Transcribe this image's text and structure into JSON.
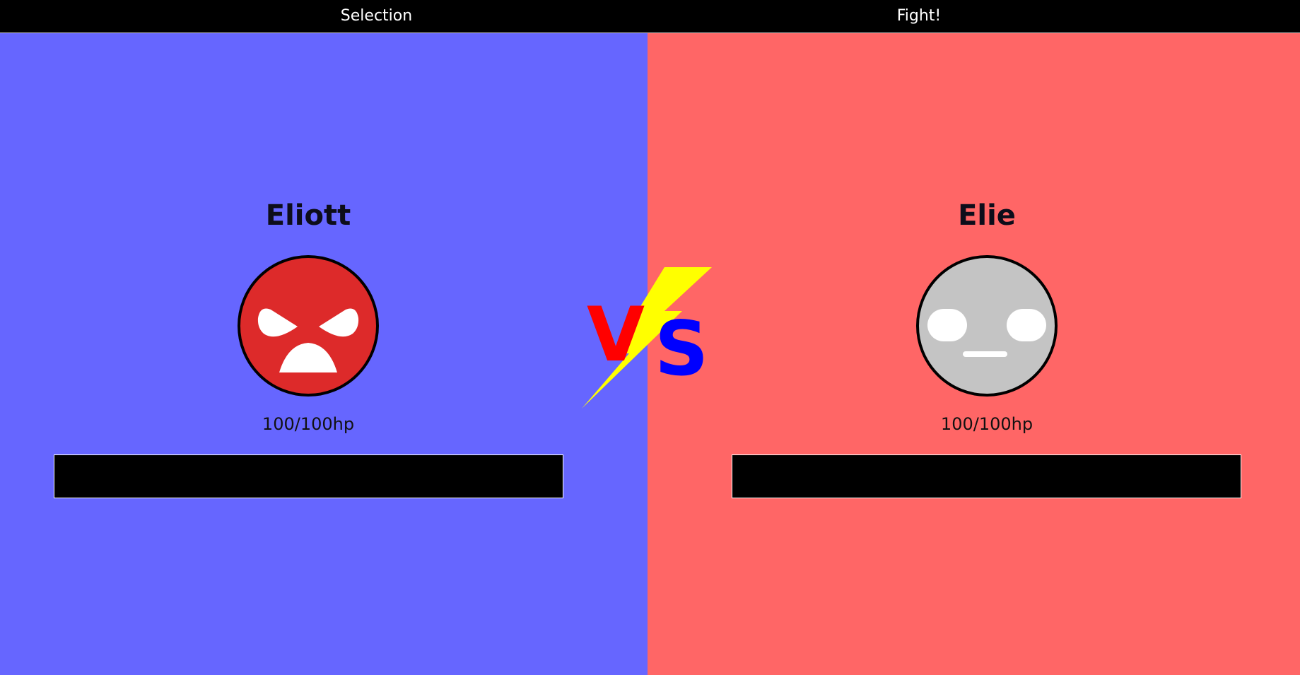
{
  "nav": {
    "selection_label": "Selection",
    "fight_label": "Fight!"
  },
  "player_left": {
    "name": "Eliott",
    "hp_text": "100/100hp",
    "hp_current": 100,
    "hp_max": 100,
    "panel_color": "#6666ff",
    "face_color": "#dd2a2a",
    "face_mood": "angry-face-icon"
  },
  "player_right": {
    "name": "Elie",
    "hp_text": "100/100hp",
    "hp_current": 100,
    "hp_max": 100,
    "panel_color": "#ff6666",
    "face_color": "#c4c4c4",
    "face_mood": "neutral-face-icon"
  },
  "versus": {
    "letter_v": "V",
    "letter_s": "S",
    "v_color": "#ff0000",
    "s_color": "#0000ff",
    "bolt_color": "#ffff00"
  }
}
